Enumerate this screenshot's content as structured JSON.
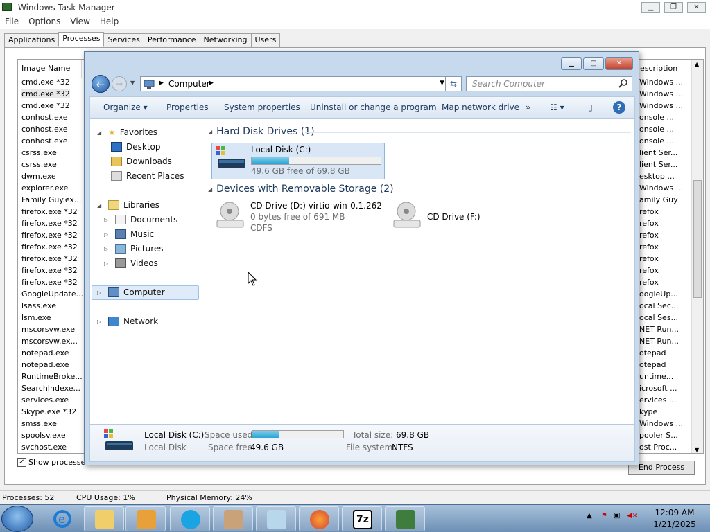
{
  "taskmgr": {
    "title": "Windows Task Manager",
    "menu": [
      "File",
      "Options",
      "View",
      "Help"
    ],
    "tabs": [
      "Applications",
      "Processes",
      "Services",
      "Performance",
      "Networking",
      "Users"
    ],
    "col_image_name": "Image Name",
    "col_description": "escription",
    "processes": [
      "cmd.exe *32",
      "cmd.exe *32",
      "cmd.exe *32",
      "conhost.exe",
      "conhost.exe",
      "conhost.exe",
      "csrss.exe",
      "csrss.exe",
      "dwm.exe",
      "explorer.exe",
      "Family Guy.ex...",
      "firefox.exe *32",
      "firefox.exe *32",
      "firefox.exe *32",
      "firefox.exe *32",
      "firefox.exe *32",
      "firefox.exe *32",
      "firefox.exe *32",
      "GoogleUpdate...",
      "lsass.exe",
      "lsm.exe",
      "mscorsvw.exe",
      "mscorsvw.ex...",
      "notepad.exe",
      "notepad.exe",
      "RuntimeBroke...",
      "SearchIndexe...",
      "services.exe",
      "Skype.exe *32",
      "smss.exe",
      "spoolsv.exe",
      "svchost.exe"
    ],
    "descriptions": [
      "Windows ...",
      "Windows ...",
      "Windows ...",
      "onsole ...",
      "onsole ...",
      "onsole ...",
      "lient Ser...",
      "lient Ser...",
      "esktop ...",
      "Windows ...",
      "amily Guy",
      "refox",
      "refox",
      "refox",
      "refox",
      "refox",
      "refox",
      "refox",
      "oogleUp...",
      "ocal Sec...",
      "ocal Ses...",
      "NET Run...",
      "NET Run...",
      "otepad",
      "otepad",
      "untime...",
      "icrosoft ...",
      "ervices ...",
      "kype",
      "Windows ...",
      "pooler S...",
      "ost Proc..."
    ],
    "show_processes": "Show processes",
    "end_process": "End Process",
    "status_processes": "Processes: 52",
    "status_cpu": "CPU Usage: 1%",
    "status_memory": "Physical Memory: 24%"
  },
  "explorer": {
    "address": "Computer",
    "search_placeholder": "Search Computer",
    "commands": {
      "organize": "Organize",
      "properties": "Properties",
      "system_properties": "System properties",
      "uninstall": "Uninstall or change a program",
      "map_drive": "Map network drive",
      "more": "»"
    },
    "nav": {
      "favorites": "Favorites",
      "desktop": "Desktop",
      "downloads": "Downloads",
      "recent": "Recent Places",
      "libraries": "Libraries",
      "documents": "Documents",
      "music": "Music",
      "pictures": "Pictures",
      "videos": "Videos",
      "computer": "Computer",
      "network": "Network"
    },
    "groups": {
      "hdd": "Hard Disk Drives (1)",
      "removable": "Devices with Removable Storage (2)"
    },
    "local_disk": {
      "name": "Local Disk (C:)",
      "free": "49.6 GB free of 69.8 GB",
      "used_fraction": 0.29
    },
    "cd_d": {
      "name": "CD Drive (D:) virtio-win-0.1.262",
      "free": "0 bytes free of 691 MB",
      "fs": "CDFS"
    },
    "cd_f": {
      "name": "CD Drive (F:)"
    },
    "details": {
      "name": "Local Disk (C:)",
      "type": "Local Disk",
      "space_used_label": "Space used:",
      "space_free_label": "Space free:",
      "space_free": "49.6 GB",
      "total_label": "Total size:",
      "total": "69.8 GB",
      "fs_label": "File system:",
      "fs": "NTFS"
    }
  },
  "taskbar": {
    "time": "12:09 AM",
    "date": "1/21/2025",
    "seven_zip": "7z"
  }
}
